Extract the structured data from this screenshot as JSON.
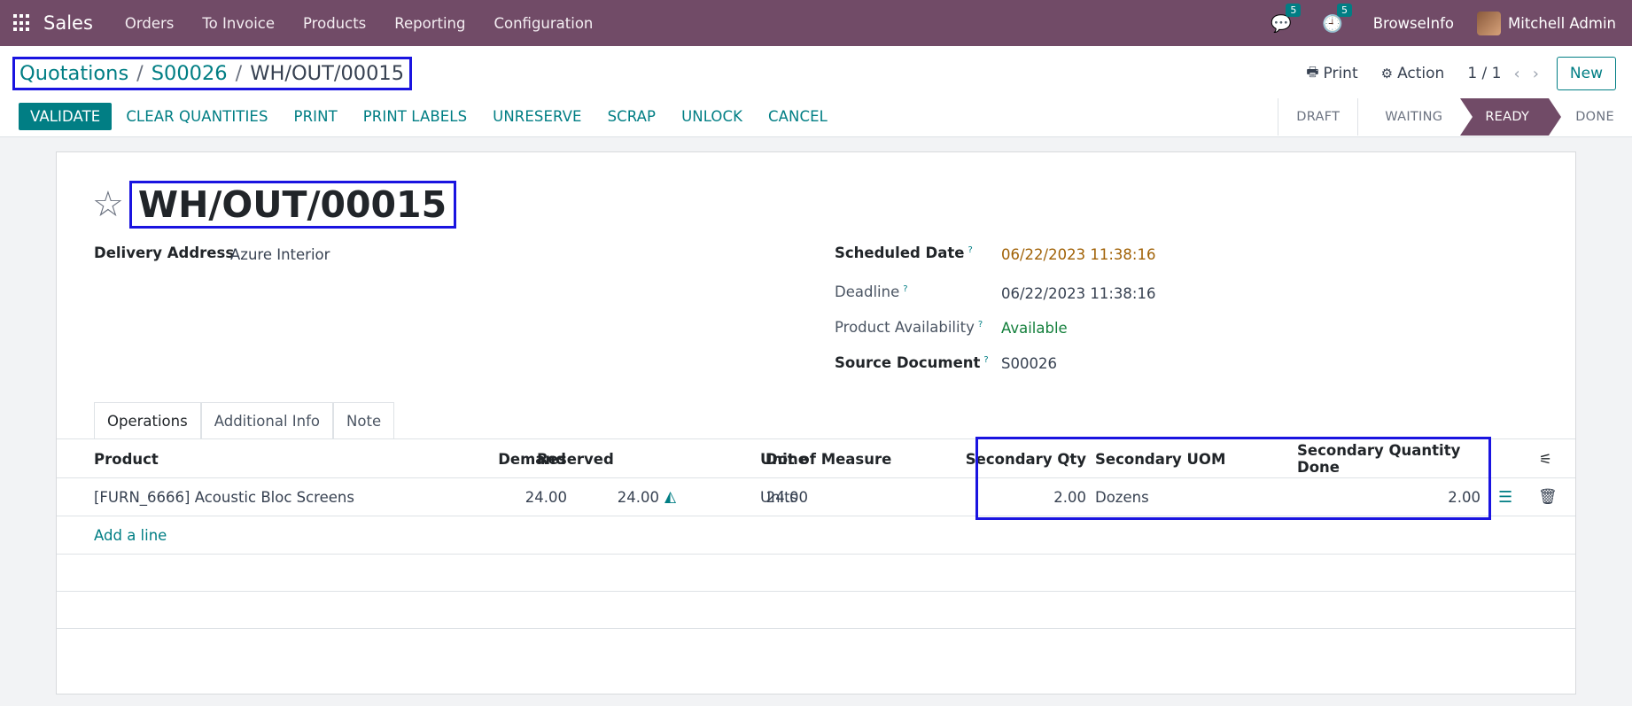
{
  "topbar": {
    "app_name": "Sales",
    "menu": [
      "Orders",
      "To Invoice",
      "Products",
      "Reporting",
      "Configuration"
    ],
    "messages_count": "5",
    "activities_count": "5",
    "company": "BrowseInfo",
    "user": "Mitchell Admin"
  },
  "breadcrumb": {
    "items": [
      "Quotations",
      "S00026"
    ],
    "current": "WH/OUT/00015",
    "separator": "/"
  },
  "control_panel": {
    "print_label": "Print",
    "action_label": "Action",
    "pager": "1 / 1",
    "new_label": "New"
  },
  "actions": {
    "validate": "VALIDATE",
    "clear_quantities": "CLEAR QUANTITIES",
    "print": "PRINT",
    "print_labels": "PRINT LABELS",
    "unreserve": "UNRESERVE",
    "scrap": "SCRAP",
    "unlock": "UNLOCK",
    "cancel": "CANCEL"
  },
  "status": {
    "stages": [
      "DRAFT",
      "WAITING",
      "READY",
      "DONE"
    ],
    "active": "READY"
  },
  "record": {
    "title": "WH/OUT/00015",
    "delivery_address_label": "Delivery Address",
    "delivery_address": "Azure Interior",
    "scheduled_date_label": "Scheduled Date",
    "scheduled_date": "06/22/2023 11:38:16",
    "deadline_label": "Deadline",
    "deadline": "06/22/2023 11:38:16",
    "availability_label": "Product Availability",
    "availability": "Available",
    "source_document_label": "Source Document",
    "source_document": "S00026",
    "help_mark": "?"
  },
  "tabs": [
    "Operations",
    "Additional Info",
    "Note"
  ],
  "operations": {
    "columns": {
      "product": "Product",
      "demand": "Demand",
      "reserved": "Reserved",
      "done": "Done",
      "uom": "Unit of Measure",
      "secondary_qty": "Secondary Qty",
      "secondary_uom": "Secondary UOM",
      "secondary_done": "Secondary Quantity Done"
    },
    "rows": [
      {
        "product": "[FURN_6666] Acoustic Bloc Screens",
        "demand": "24.00",
        "reserved": "24.00",
        "done": "24.00",
        "uom": "Units",
        "secondary_qty": "2.00",
        "secondary_uom": "Dozens",
        "secondary_done": "2.00"
      }
    ],
    "add_line": "Add a line"
  },
  "colors": {
    "brand": "#714b67",
    "link": "#017e84",
    "highlight_box": "#1a14e0",
    "scheduled_date": "#a16207",
    "available": "#15803d"
  }
}
